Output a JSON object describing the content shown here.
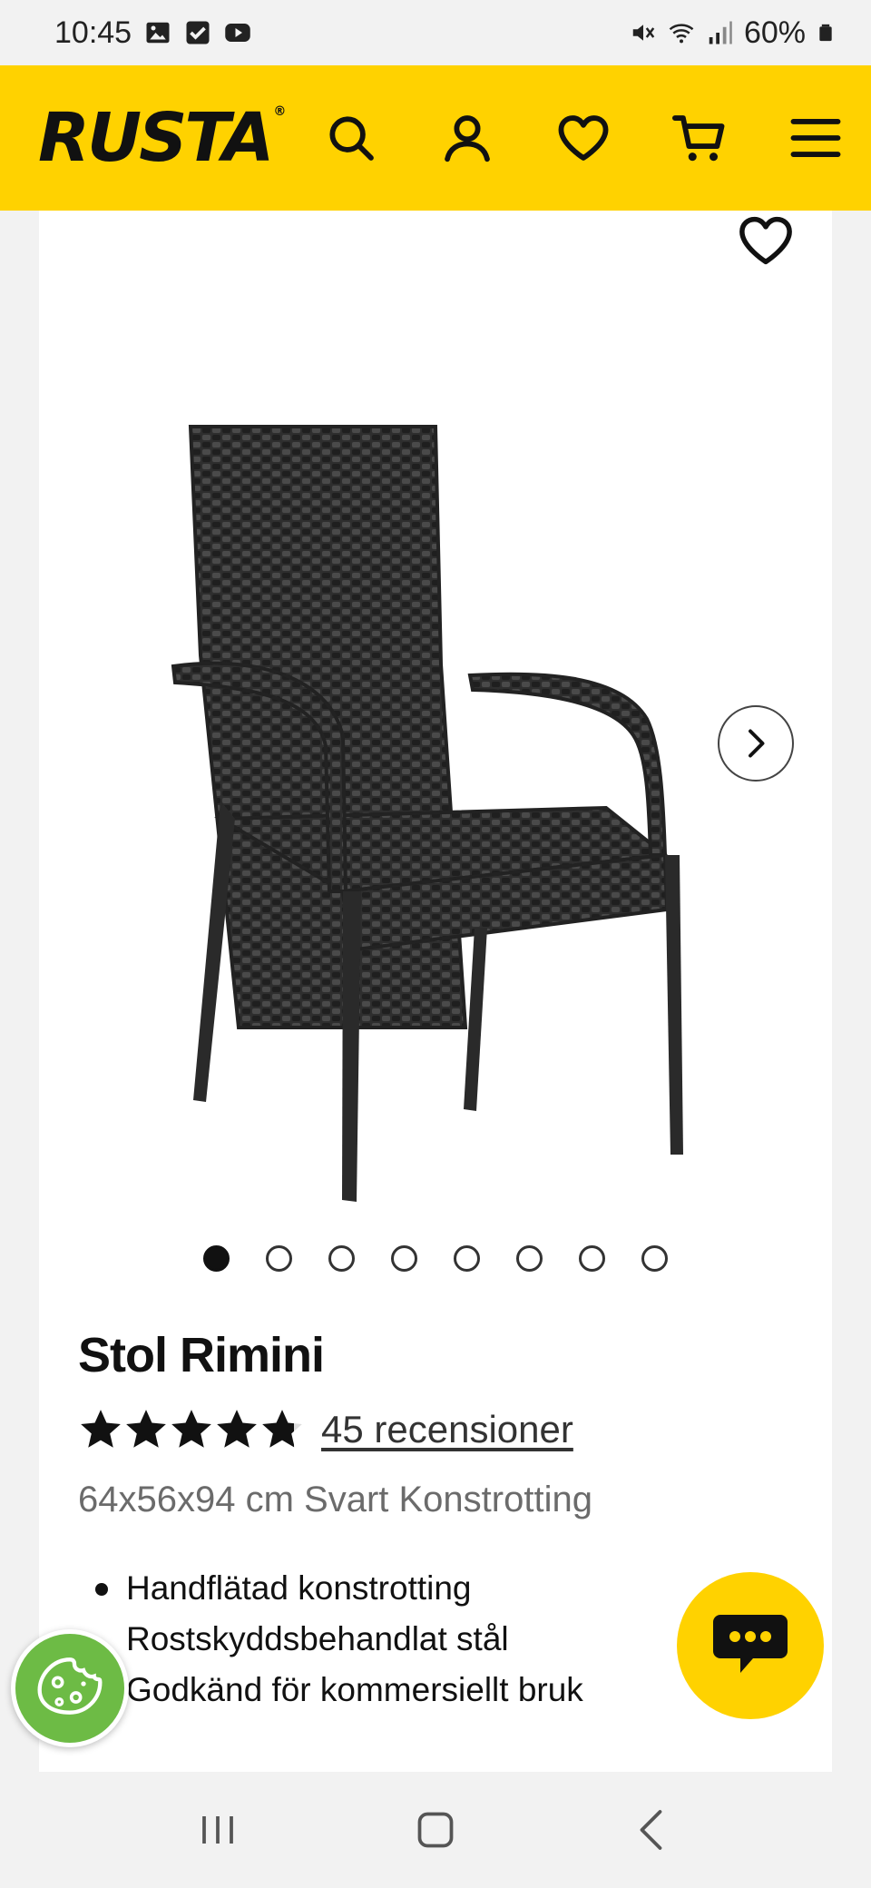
{
  "status_bar": {
    "time": "10:45",
    "battery": "60%",
    "left_icons": [
      "gallery-icon",
      "checkbox-icon",
      "youtube-icon"
    ],
    "right_icons": [
      "mute-icon",
      "wifi-icon",
      "signal-icon",
      "battery-icon"
    ]
  },
  "header": {
    "logo_text": "RUSTA",
    "logo_mark": "®",
    "background": "#ffd200",
    "icons": [
      "search-icon",
      "account-icon",
      "heart-icon",
      "cart-icon",
      "menu-icon"
    ]
  },
  "gallery": {
    "image_count": 8,
    "active_index": 0,
    "image_alt": "Stol Rimini"
  },
  "product": {
    "title": "Stol Rimini",
    "rating": 4.8,
    "rating_max": 5,
    "reviews_label": "45 recensioner",
    "subtitle": "64x56x94 cm Svart Konstrotting",
    "features": [
      "Handflätad konstrotting",
      "Rostskyddsbehandlat stål",
      "Godkänd för kommersiellt bruk"
    ]
  },
  "colors": {
    "brand_yellow": "#ffd200",
    "cookie_green": "#6dbb45"
  }
}
